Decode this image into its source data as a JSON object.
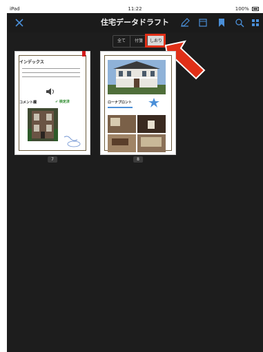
{
  "statusbar": {
    "carrier": "iPad",
    "time": "11:22",
    "battery": "100%"
  },
  "navbar": {
    "title": "住宅データドラフト",
    "close_icon": "close-icon",
    "icons": [
      "edit-icon",
      "window-icon",
      "bookmark-icon",
      "search-icon",
      "grid-icon"
    ]
  },
  "segment": {
    "options": [
      "全て",
      "付箋",
      "しおり"
    ],
    "selected": "しおり"
  },
  "pages": [
    {
      "number": "7",
      "index_title": "インデックス",
      "comment_label": "コメント欄",
      "check_label": "✔ 検定済",
      "bookmarked": true
    },
    {
      "number": "8",
      "section_label": "ローナプロント"
    }
  ],
  "colors": {
    "accent_blue": "#4a8fd8",
    "highlight_red": "#e03018",
    "background": "#1d1d1d"
  }
}
